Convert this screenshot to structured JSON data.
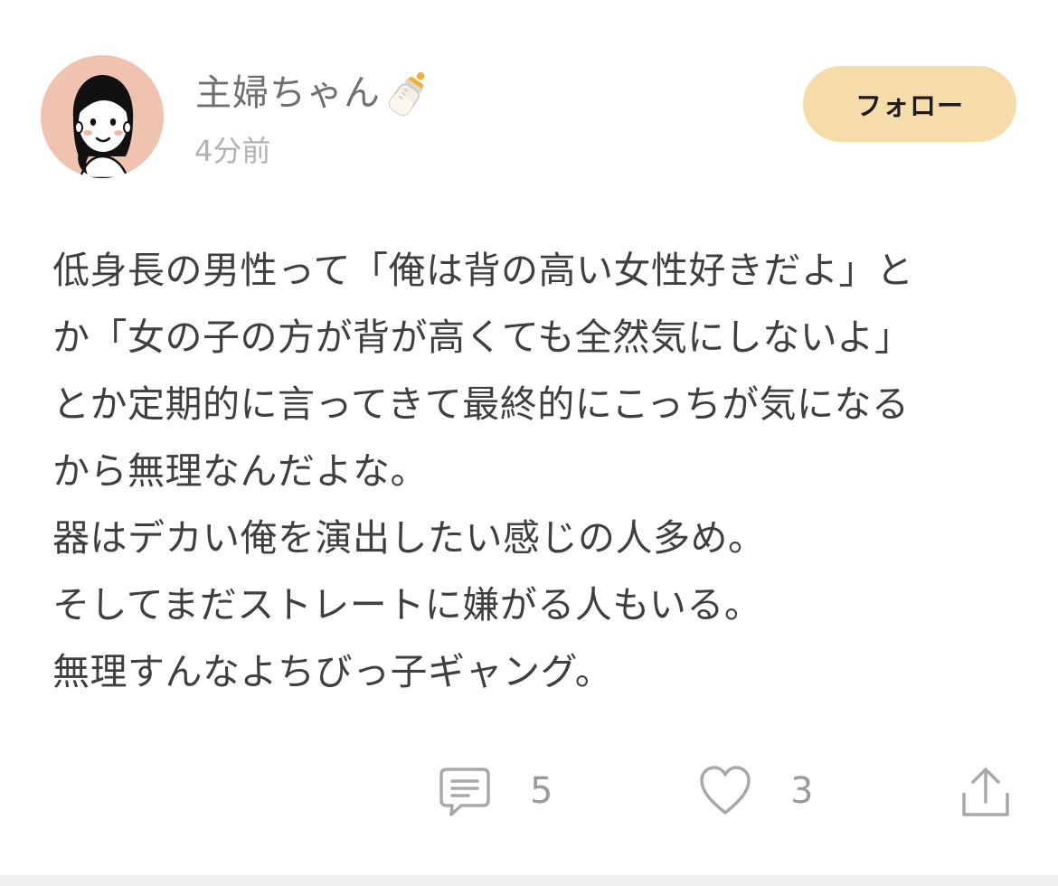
{
  "post": {
    "author": {
      "name": "主婦ちゃん",
      "badge_icon": "baby-bottle-icon",
      "avatar_icon": "woman-avatar-illustration",
      "avatar_bg": "#efc3af"
    },
    "timestamp": "4分前",
    "follow_label": "フォロー",
    "follow_bg": "#f6dcab",
    "body_lines": [
      "低身長の男性って「俺は背の高い女性好きだよ」と",
      "か「女の子の方が背が高くても全然気にしないよ」",
      "とか定期的に言ってきて最終的にこっちが気になる",
      "から無理なんだよな。",
      "器はデカい俺を演出したい感じの人多め。",
      "そしてまだストレートに嫌がる人もいる。",
      "無理すんなよちびっ子ギャング。"
    ],
    "actions": {
      "comment": {
        "icon": "comment-icon",
        "count": "5"
      },
      "like": {
        "icon": "heart-icon",
        "count": "3"
      },
      "share": {
        "icon": "share-icon"
      }
    }
  }
}
